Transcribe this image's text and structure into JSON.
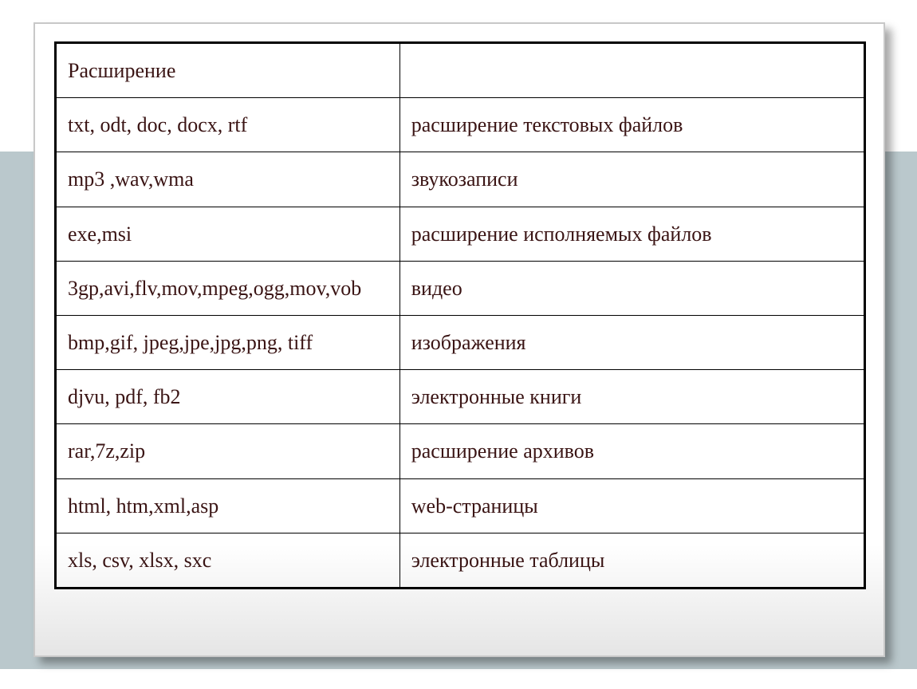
{
  "table": {
    "header": {
      "left": "Расширение",
      "right": ""
    },
    "rows": [
      {
        "ext": "txt, odt, doc, docx, rtf",
        "desc": "расширение текстовых файлов"
      },
      {
        "ext": "mp3 ,wav,wma",
        "desc": "звукозаписи"
      },
      {
        "ext": "exe,msi",
        "desc": "расширение исполняемых файлов"
      },
      {
        "ext": "3gp,avi,flv,mov,mpeg,ogg,mov,vob",
        "desc": " видео"
      },
      {
        "ext": "bmp,gif, jpeg,jpe,jpg,png, tiff",
        "desc": "изображения"
      },
      {
        "ext": "djvu, pdf, fb2",
        "desc": "электронные книги"
      },
      {
        "ext": "rar,7z,zip",
        "desc": "расширение архивов"
      },
      {
        "ext": "html, htm,xml,asp",
        "desc": "web-страницы"
      },
      {
        "ext": "xls, csv, xlsx, sxc",
        "desc": "электронные таблицы"
      }
    ]
  }
}
